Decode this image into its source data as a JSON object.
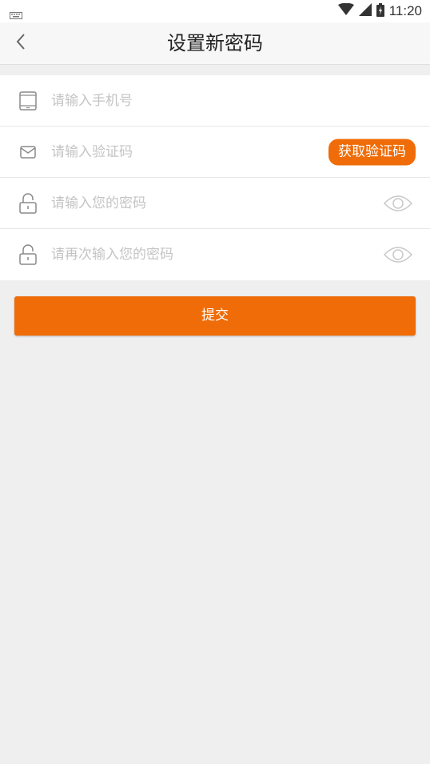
{
  "status_bar": {
    "time": "11:20",
    "icons": [
      "keyboard-icon",
      "wifi-icon",
      "signal-icon",
      "battery-icon"
    ]
  },
  "header": {
    "title": "设置新密码",
    "back_icon": "chevron-left-icon"
  },
  "form": {
    "phone": {
      "placeholder": "请输入手机号",
      "value": "",
      "icon": "phone-icon"
    },
    "code": {
      "placeholder": "请输入验证码",
      "value": "",
      "icon": "mail-icon",
      "button_label": "获取验证码"
    },
    "password": {
      "placeholder": "请输入您的密码",
      "value": "",
      "icon": "lock-icon",
      "toggle_icon": "eye-icon"
    },
    "confirm_password": {
      "placeholder": "请再次输入您的密码",
      "value": "",
      "icon": "lock-icon",
      "toggle_icon": "eye-icon"
    }
  },
  "submit_label": "提交",
  "colors": {
    "accent": "#ef6c08",
    "background": "#efefef",
    "placeholder": "#c4c4c4",
    "icon": "#8a8a8a"
  }
}
